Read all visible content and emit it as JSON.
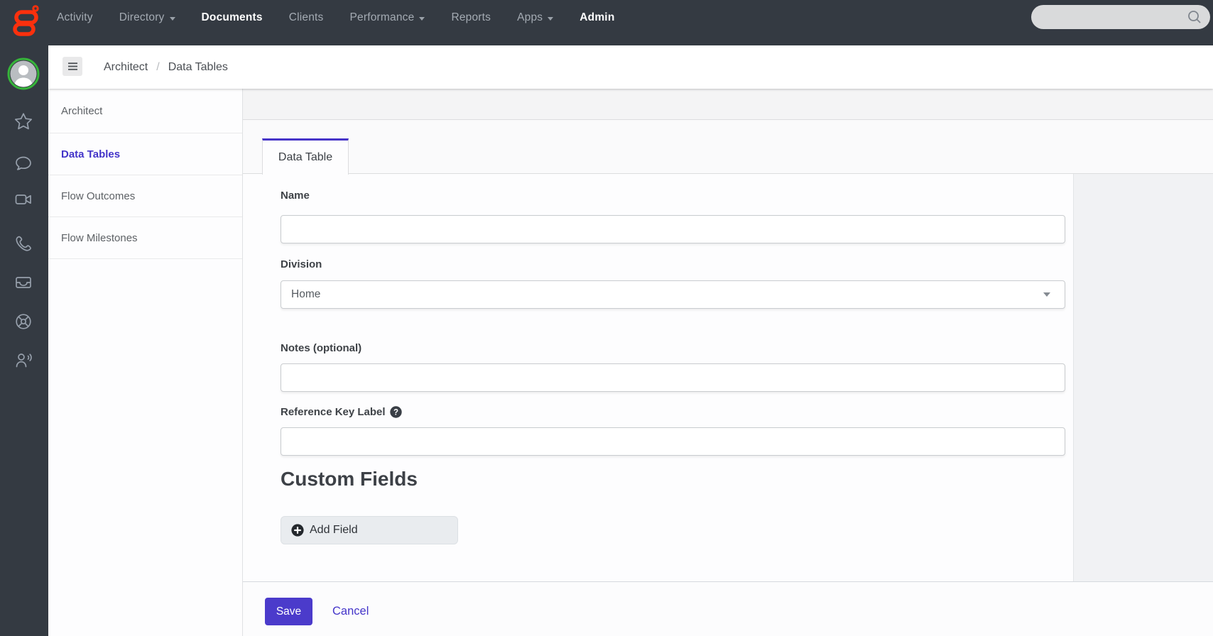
{
  "colors": {
    "accent": "#4634c8",
    "nav_bg": "#343a42",
    "logo_red": "#fb300d",
    "avatar_ring": "#36b43a"
  },
  "topnav": {
    "items": [
      {
        "label": "Activity"
      },
      {
        "label": "Directory"
      },
      {
        "label": "Documents"
      },
      {
        "label": "Clients"
      },
      {
        "label": "Performance"
      },
      {
        "label": "Reports"
      },
      {
        "label": "Apps"
      },
      {
        "label": "Admin"
      }
    ],
    "search": {
      "value": "",
      "placeholder": ""
    }
  },
  "breadcrumb": {
    "items": [
      "Architect",
      "Data Tables"
    ],
    "separator": "/"
  },
  "sidebar": {
    "icons": [
      "avatar",
      "star-icon",
      "chat-icon",
      "video-camera-icon",
      "phone-icon",
      "inbox-icon",
      "help-ring-icon",
      "agent-icon"
    ]
  },
  "side_menu": {
    "items": [
      {
        "label": "Architect"
      },
      {
        "label": "Data Tables"
      },
      {
        "label": "Flow Outcomes"
      },
      {
        "label": "Flow Milestones"
      }
    ]
  },
  "tab": {
    "label": "Data Table"
  },
  "form": {
    "name": {
      "label": "Name",
      "value": ""
    },
    "division": {
      "label": "Division",
      "value": "Home"
    },
    "notes": {
      "label": "Notes (optional)",
      "value": ""
    },
    "reference_key": {
      "label": "Reference Key Label",
      "value": "",
      "help_icon": "question-circle"
    },
    "custom_fields": {
      "heading": "Custom Fields",
      "add_button": "Add Field"
    }
  },
  "actions": {
    "save": "Save",
    "cancel": "Cancel"
  }
}
